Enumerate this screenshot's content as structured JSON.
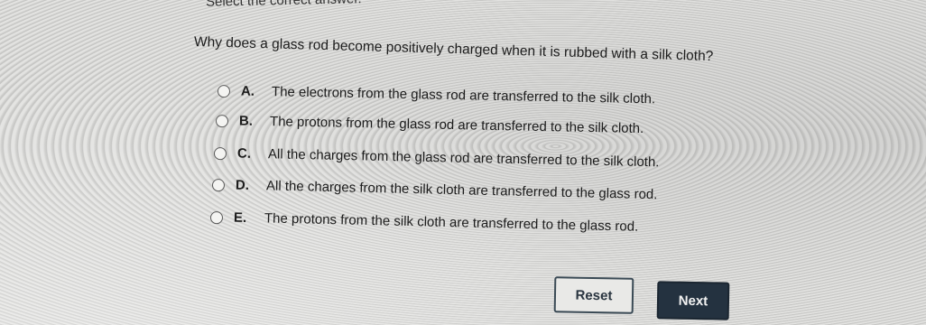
{
  "instruction": "Select the correct answer.",
  "question": "Why does a glass rod become positively charged when it is rubbed with a silk cloth?",
  "options": [
    {
      "letter": "A.",
      "text": "The electrons from the glass rod are transferred to the silk cloth."
    },
    {
      "letter": "B.",
      "text": "The protons from the glass rod are transferred to the silk cloth."
    },
    {
      "letter": "C.",
      "text": "All the charges from the glass rod are transferred to the silk cloth."
    },
    {
      "letter": "D.",
      "text": "All the charges from the silk cloth are transferred to the glass rod."
    },
    {
      "letter": "E.",
      "text": "The protons from the silk cloth are transferred to the glass rod."
    }
  ],
  "buttons": {
    "reset_label": "Reset",
    "next_label": "Next"
  },
  "colors": {
    "next_background": "#243240",
    "reset_border": "#3a4a55"
  }
}
